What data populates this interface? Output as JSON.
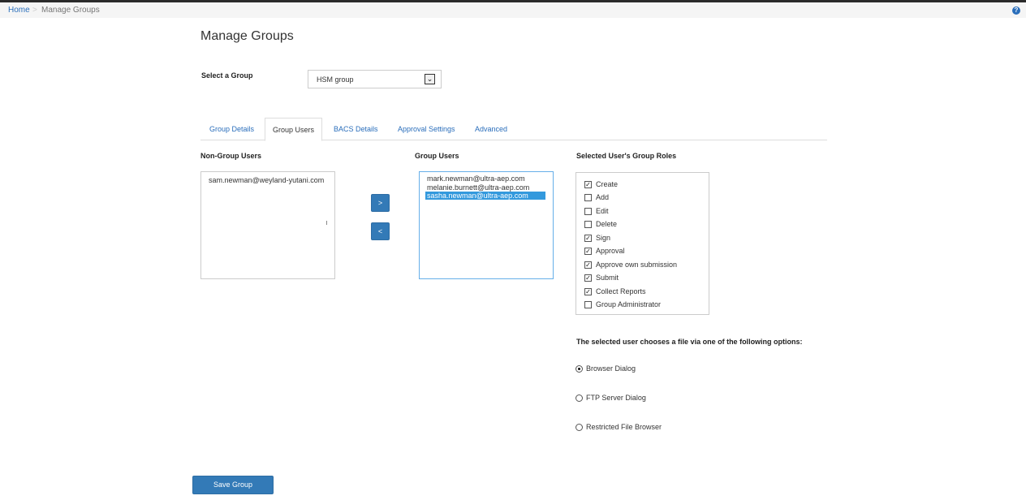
{
  "breadcrumb": {
    "home": "Home",
    "separator": ">",
    "current": "Manage Groups"
  },
  "help_icon": {
    "glyph": "?",
    "icon": "question-circle-icon"
  },
  "page_title": "Manage Groups",
  "group_select": {
    "label": "Select a Group",
    "value": "HSM group",
    "arrow": "⌄"
  },
  "tabs": [
    {
      "label": "Group Details",
      "active": false
    },
    {
      "label": "Group Users",
      "active": true
    },
    {
      "label": "BACS Details",
      "active": false
    },
    {
      "label": "Approval Settings",
      "active": false
    },
    {
      "label": "Advanced",
      "active": false
    }
  ],
  "non_group_users": {
    "heading": "Non-Group Users",
    "items": [
      "sam.newman@weyland-yutani.com"
    ]
  },
  "move_buttons": {
    "add": ">",
    "remove": "<"
  },
  "group_users": {
    "heading": "Group Users",
    "items": [
      "mark.newman@ultra-aep.com",
      "melanie.burnett@ultra-aep.com",
      "sasha.newman@ultra-aep.com"
    ],
    "selected_index": 2
  },
  "roles": {
    "heading": "Selected User's Group Roles",
    "items": [
      {
        "label": "Create",
        "checked": true
      },
      {
        "label": "Add",
        "checked": false
      },
      {
        "label": "Edit",
        "checked": false
      },
      {
        "label": "Delete",
        "checked": false
      },
      {
        "label": "Sign",
        "checked": true
      },
      {
        "label": "Approval",
        "checked": true
      },
      {
        "label": "Approve own submission",
        "checked": true
      },
      {
        "label": "Submit",
        "checked": true
      },
      {
        "label": "Collect Reports",
        "checked": true
      },
      {
        "label": "Group Administrator",
        "checked": false
      }
    ]
  },
  "file_options": {
    "heading": "The selected user chooses a file via one of the following options:",
    "items": [
      {
        "label": "Browser Dialog",
        "selected": true
      },
      {
        "label": "FTP Server Dialog",
        "selected": false
      },
      {
        "label": "Restricted File Browser",
        "selected": false
      }
    ]
  },
  "save_button": "Save Group",
  "colors": {
    "link": "#2a6ebb",
    "primary_button": "#337ab7",
    "selection": "#3399dd"
  }
}
